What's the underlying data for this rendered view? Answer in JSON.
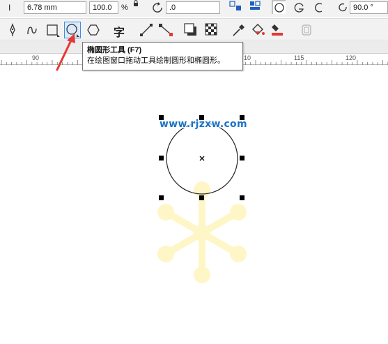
{
  "property_bar": {
    "width_value": "6.78 mm",
    "scale_value": "100.0",
    "percent_sign": "%",
    "rotation_value": ".0",
    "angle_value": "90.0 °"
  },
  "toolbox": {
    "tools": [
      {
        "name": "pick-tool",
        "icon": "pen-nib-icon"
      },
      {
        "name": "freehand-tool",
        "icon": "curve-icon"
      },
      {
        "name": "rectangle-tool",
        "icon": "rectangle-icon"
      },
      {
        "name": "ellipse-tool",
        "icon": "ellipse-icon",
        "active": true
      },
      {
        "name": "polygon-tool",
        "icon": "polygon-icon"
      },
      {
        "name": "text-tool",
        "icon": "text-icon",
        "label": "字"
      },
      {
        "name": "dimension-tool",
        "icon": "line-icon"
      },
      {
        "name": "connector-tool",
        "icon": "connector-icon"
      },
      {
        "name": "drop-shadow-tool",
        "icon": "shadow-icon"
      },
      {
        "name": "transparency-tool",
        "icon": "checker-icon"
      },
      {
        "name": "eyedropper-tool",
        "icon": "eyedropper-icon"
      },
      {
        "name": "fill-tool",
        "icon": "bucket-icon"
      },
      {
        "name": "smart-fill-tool",
        "icon": "smart-fill-icon"
      },
      {
        "name": "lock-tool",
        "icon": "lock-icon"
      }
    ],
    "accent_color": "#3c8ee0",
    "arrow_color": "#e53935"
  },
  "ruler": {
    "labels": [
      "90",
      "10",
      "115",
      "120"
    ]
  },
  "tooltip": {
    "title": "椭圆形工具 (F7)",
    "description": "在绘图窗口拖动工具绘制圆形和椭圆形。"
  },
  "canvas": {
    "watermark": "www.rjzxw.com",
    "watermark_color": "#1a73c8",
    "snowflake_color": "#fff6c8"
  }
}
